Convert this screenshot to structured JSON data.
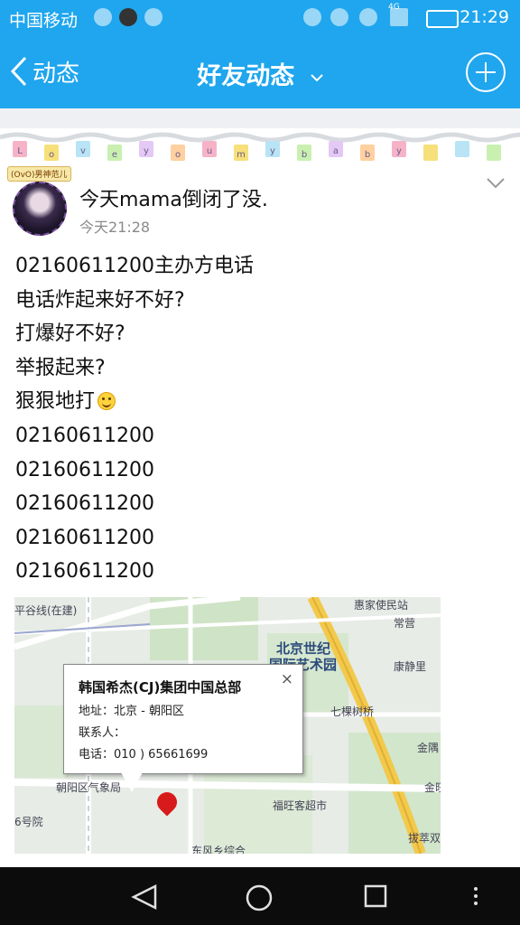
{
  "status_bar": {
    "carrier": "中国移动",
    "time": "21:29",
    "network": "4G"
  },
  "nav": {
    "back_label": "动态",
    "title": "好友动态"
  },
  "banner": {
    "letters": [
      "L",
      "o",
      "v",
      "e",
      "y",
      "o",
      "u",
      "m",
      "y",
      "b",
      "a",
      "b",
      "y"
    ]
  },
  "post": {
    "avatar_tag": "(OvO)男神范儿",
    "title": "今天mama倒闭了没.",
    "time": "今天21:28",
    "lines": [
      "02160611200主办方电话",
      "电话炸起来好不好?",
      "打爆好不好?",
      "举报起来?",
      "狠狠地打",
      "02160611200",
      "02160611200",
      "02160611200",
      "02160611200",
      "02160611200"
    ]
  },
  "map": {
    "labels": {
      "road_ping": "平谷线(在建)",
      "park": "惠家使民站",
      "changying": "常营",
      "beijing_art_1": "北京世纪",
      "beijing_art_2": "国际艺术园",
      "kangjing": "康静里",
      "qikeshu": "七棵树桥",
      "jinyu": "金隅",
      "jinwang": "金旺",
      "chaoyang_weather": "朝阳区气象局",
      "fuwang": "福旺客超市",
      "no6": "6号院",
      "dongfeng": "东风乡综合",
      "bazi": "拔萃双"
    },
    "popup": {
      "title": "韩国希杰(CJ)集团中国总部",
      "address": "地址：北京 - 朝阳区",
      "contact": "联系人：",
      "phone": "电话：010 ) 65661699",
      "close": "×"
    }
  },
  "colors": {
    "accent": "#1fa6ee",
    "map_bg": "#e7ece6",
    "pin": "#d71a1a"
  },
  "icons": [
    "back-icon",
    "dropdown-chevron-icon",
    "add-icon",
    "more-chevron-icon",
    "smile-emoji-icon",
    "map-pin-icon",
    "back-triangle-icon",
    "home-circle-icon",
    "recents-square-icon",
    "overflow-dots-icon"
  ]
}
